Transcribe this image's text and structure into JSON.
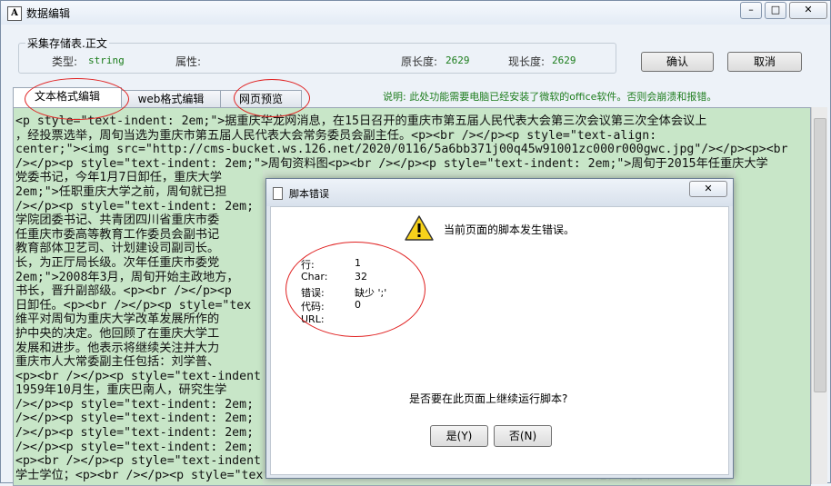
{
  "window": {
    "title": "数据编辑",
    "app_icon": "A",
    "controls": [
      "minimize-icon",
      "maximize-icon",
      "close-icon"
    ]
  },
  "storage": {
    "group_title": "采集存储表.正文",
    "type_label": "类型:",
    "type_value": "string",
    "attr_label": "属性:",
    "attr_value": "",
    "orig_len_label": "原长度:",
    "orig_len_value": "2629",
    "cur_len_label": "现长度:",
    "cur_len_value": "2629"
  },
  "buttons": {
    "ok": "确认",
    "cancel": "取消"
  },
  "tabs": [
    {
      "label": "文本格式编辑",
      "active": true
    },
    {
      "label": "web格式编辑",
      "active": false
    },
    {
      "label": "网页预览",
      "active": false
    }
  ],
  "note": "说明: 此处功能需要电脑已经安装了微软的office软件。否则会崩溃和报错。",
  "editor": {
    "background": "#c8e6c8",
    "lines": [
      "<p style=\"text-indent: 2em;\">据重庆华龙网消息，在15日召开的重庆市第五届人民代表大会第三次会议第三次全体会议上",
      "，经投票选举，周旬当选为重庆市第五届人民代表大会常务委员会副主任。<p><br /></p><p style=\"text-align:",
      "center;\"><img src=\"http://cms-bucket.ws.126.net/2020/0116/5a6bb371j00q45w91001zc000r000gwc.jpg\"/></p><p><br",
      "/></p><p style=\"text-indent: 2em;\">周旬资料图<p><br /></p><p style=\"text-indent: 2em;\">周旬于2015年任重庆大学",
      "党委书记，今年1月7日卸任，重庆大学                                                    ",
      "2em;\">任职重庆大学之前，周旬就已担                                                indent:",
      "/></p><p style=\"text-indent: 2em;                                                 ><br",
      "学院团委书记、共青团四川省重庆市委                                                 任重庆师范",
      "任重庆市委高等教育工作委员会副书记                                                 精后，周旬",
      "教育部体卫艺司、计划建设司副司长。                                                 职在短暂挂职",
      "长，为正厅局长级。次年任重庆市委党                                                 市委副秘书",
      "2em;\">2008年3月，周旬开始主政地方，                                               indent:",
      "书长，晋升副部级。<p><br /></p><p                                                  主任兼任秘",
      "日卸任。<p><br /></p><p style=\"tex                                                至今年1月7",
      "维平对周旬为重庆大学改革发展所作的                                                 三局局长王",
      "护中央的决定。他回顾了在重庆大学工                                                 表示坚决拥",
      "发展和进步。他表示将继续关注并大力                                                 学校的长足",
      "重庆市人大常委副主任包括：刘学普、                                                 次当选后，",
      "<p><br /></p><p style=\"text-indent                                                为张轩。",
      "1959年10月生，重庆巴南人，研究生学                                                 男，汉族，",
      "/></p><p style=\"text-indent: 2em;                                                 记。</p><p><br",
      "/></p><p style=\"text-indent: 2em;                                                 区副书记；",
      "/></p><p style=\"text-indent: 2em;                                                 主任；<p><br",
      "/></p><p style=\"text-indent: 2em;                                                 助教;",
      "<p><br /></p><p style=\"text-indent                                                司，获法学",
      "学士学位；<p><br /></p><p style=\"text-indent                                      记，团委书"
    ]
  },
  "dialog": {
    "title": "脚本错误",
    "close_glyph": "✕",
    "message": "当前页面的脚本发生错误。",
    "info": [
      {
        "key": "行:",
        "value": "1"
      },
      {
        "key": "Char:",
        "value": "32"
      },
      {
        "key": "错误:",
        "value": "缺少 ';'"
      },
      {
        "key": "代码:",
        "value": "0"
      },
      {
        "key": "URL:",
        "value": ""
      }
    ],
    "question": "是否要在此页面上继续运行脚本?",
    "yes": "是(Y)",
    "no": "否(N)"
  },
  "colors": {
    "annotation": "#e02020",
    "field_value": "#1a7c1a",
    "note": "#1e7d1e"
  }
}
